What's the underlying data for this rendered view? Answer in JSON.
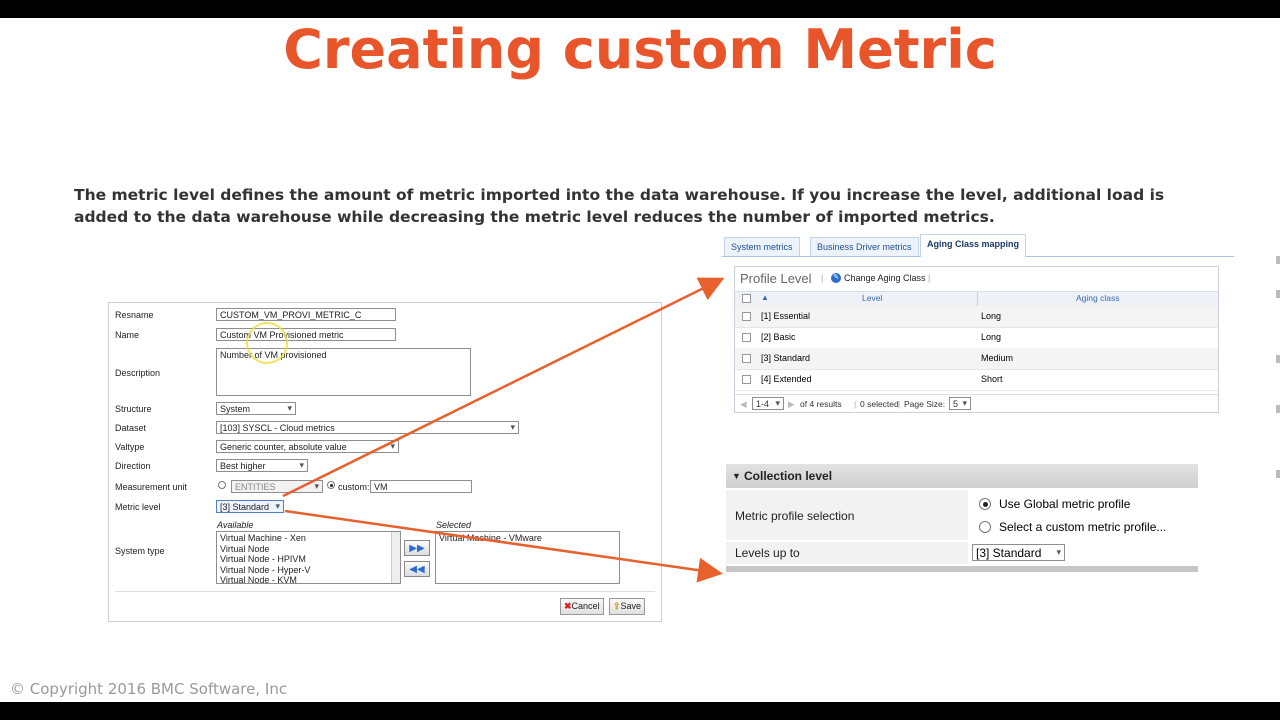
{
  "slide": {
    "title": "Creating custom Metric",
    "paragraph": "The metric level defines the amount of metric imported into the data warehouse. If you increase the level, additional load is added to the data warehouse while decreasing the metric level reduces the number of imported metrics.",
    "copyright": "© Copyright 2016 BMC Software, Inc"
  },
  "colors": {
    "title": "#e8552b",
    "arrow": "#e8602c"
  },
  "form": {
    "resname": {
      "label": "Resname",
      "value": "CUSTOM_VM_PROVI_METRIC_C"
    },
    "name": {
      "label": "Name",
      "value": "Custom VM Provisioned metric"
    },
    "description": {
      "label": "Description",
      "value": "Number of VM provisioned"
    },
    "structure": {
      "label": "Structure",
      "value": "System"
    },
    "dataset": {
      "label": "Dataset",
      "value": "[103] SYSCL - Cloud metrics"
    },
    "valtype": {
      "label": "Valtype",
      "value": "Generic counter, absolute value"
    },
    "direction": {
      "label": "Direction",
      "value": "Best higher"
    },
    "measurement_unit": {
      "label": "Measurement unit",
      "entities": "ENTITIES",
      "custom_label": "custom:",
      "custom_value": "VM"
    },
    "metric_level": {
      "label": "Metric level",
      "value": "[3] Standard"
    },
    "system_type": {
      "label": "System type",
      "available_label": "Available",
      "selected_label": "Selected",
      "available": [
        "Virtual Machine - Xen",
        "Virtual Node",
        "Virtual Node - HPIVM",
        "Virtual Node - Hyper-V",
        "Virtual Node - KVM"
      ],
      "selected": [
        "Virtual Machine - VMware"
      ]
    },
    "cancel_label": "Cancel",
    "save_label": "Save"
  },
  "aging_panel": {
    "tabs": [
      "System metrics",
      "Business Driver metrics",
      "Aging Class mapping"
    ],
    "active_tab": "Aging Class mapping",
    "header": "Profile Level",
    "action": "Change Aging Class",
    "columns": [
      "Level",
      "Aging class"
    ],
    "rows": [
      {
        "level": "[1] Essential",
        "aging": "Long"
      },
      {
        "level": "[2] Basic",
        "aging": "Long"
      },
      {
        "level": "[3] Standard",
        "aging": "Medium"
      },
      {
        "level": "[4] Extended",
        "aging": "Short"
      }
    ],
    "pager": {
      "range": "1-4",
      "of_results": "of 4 results",
      "selected": "0 selected",
      "page_size_label": "Page Size:",
      "page_size": "5"
    }
  },
  "collection": {
    "header": "Collection level",
    "metric_profile_label": "Metric profile selection",
    "option_global": "Use Global metric profile",
    "option_custom": "Select a custom metric profile...",
    "levels_label": "Levels up to",
    "levels_value": "[3] Standard"
  }
}
